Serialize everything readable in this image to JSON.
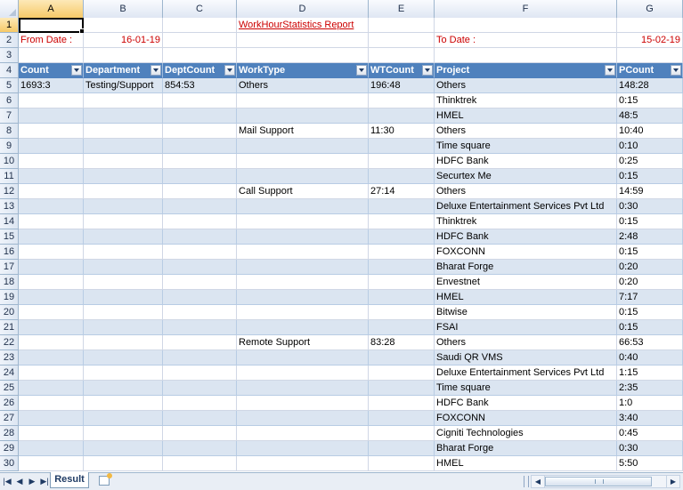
{
  "columns": [
    "A",
    "B",
    "C",
    "D",
    "E",
    "F",
    "G"
  ],
  "row_numbers": [
    "1",
    "2",
    "3",
    "4",
    "5",
    "6",
    "7",
    "8",
    "9",
    "10",
    "11",
    "12",
    "13",
    "14",
    "15",
    "16",
    "17",
    "18",
    "19",
    "20",
    "21",
    "22",
    "23",
    "24",
    "25",
    "26",
    "27",
    "28",
    "29",
    "30"
  ],
  "report": {
    "title": "WorkHourStatistics Report",
    "from_label": "From Date :",
    "from_value": "16-01-19",
    "to_label": "To Date :",
    "to_value": "15-02-19"
  },
  "table": {
    "headers": [
      "Count",
      "Department",
      "DeptCount",
      "WorkType",
      "WTCount",
      "Project",
      "PCount"
    ],
    "rows": [
      [
        "1693:3",
        "Testing/Support",
        "854:53",
        "Others",
        "196:48",
        "Others",
        "148:28"
      ],
      [
        "",
        "",
        "",
        "",
        "",
        "Thinktrek",
        "0:15"
      ],
      [
        "",
        "",
        "",
        "",
        "",
        "HMEL",
        "48:5"
      ],
      [
        "",
        "",
        "",
        "Mail Support",
        "11:30",
        "Others",
        "10:40"
      ],
      [
        "",
        "",
        "",
        "",
        "",
        "Time square",
        "0:10"
      ],
      [
        "",
        "",
        "",
        "",
        "",
        "HDFC Bank",
        "0:25"
      ],
      [
        "",
        "",
        "",
        "",
        "",
        "Securtex Me",
        "0:15"
      ],
      [
        "",
        "",
        "",
        "Call Support",
        "27:14",
        "Others",
        "14:59"
      ],
      [
        "",
        "",
        "",
        "",
        "",
        "Deluxe Entertainment Services Pvt Ltd",
        "0:30"
      ],
      [
        "",
        "",
        "",
        "",
        "",
        "Thinktrek",
        "0:15"
      ],
      [
        "",
        "",
        "",
        "",
        "",
        "HDFC Bank",
        "2:48"
      ],
      [
        "",
        "",
        "",
        "",
        "",
        "FOXCONN",
        "0:15"
      ],
      [
        "",
        "",
        "",
        "",
        "",
        "Bharat Forge",
        "0:20"
      ],
      [
        "",
        "",
        "",
        "",
        "",
        "Envestnet",
        "0:20"
      ],
      [
        "",
        "",
        "",
        "",
        "",
        "HMEL",
        "7:17"
      ],
      [
        "",
        "",
        "",
        "",
        "",
        "Bitwise",
        "0:15"
      ],
      [
        "",
        "",
        "",
        "",
        "",
        "FSAI",
        "0:15"
      ],
      [
        "",
        "",
        "",
        "Remote Support",
        "83:28",
        "Others",
        "66:53"
      ],
      [
        "",
        "",
        "",
        "",
        "",
        "Saudi QR VMS",
        "0:40"
      ],
      [
        "",
        "",
        "",
        "",
        "",
        "Deluxe Entertainment Services Pvt Ltd",
        "1:15"
      ],
      [
        "",
        "",
        "",
        "",
        "",
        "Time square",
        "2:35"
      ],
      [
        "",
        "",
        "",
        "",
        "",
        "HDFC Bank",
        "1:0"
      ],
      [
        "",
        "",
        "",
        "",
        "",
        "FOXCONN",
        "3:40"
      ],
      [
        "",
        "",
        "",
        "",
        "",
        "Cigniti Technologies",
        "0:45"
      ],
      [
        "",
        "",
        "",
        "",
        "",
        "Bharat Forge",
        "0:30"
      ],
      [
        "",
        "",
        "",
        "",
        "",
        "HMEL",
        "5:50"
      ]
    ]
  },
  "sheet_tabs": [
    {
      "label": "Result",
      "active": true
    }
  ],
  "icons": {
    "new_sheet": "insert-worksheet-icon",
    "nav_first": "first-sheet-icon",
    "nav_prev": "prev-sheet-icon",
    "nav_next": "next-sheet-icon",
    "nav_last": "last-sheet-icon",
    "filter": "autofilter-dropdown-icon"
  },
  "colors": {
    "header_fill": "#4f81bd",
    "band_fill": "#dbe5f1",
    "accent_red": "#cc0000"
  }
}
